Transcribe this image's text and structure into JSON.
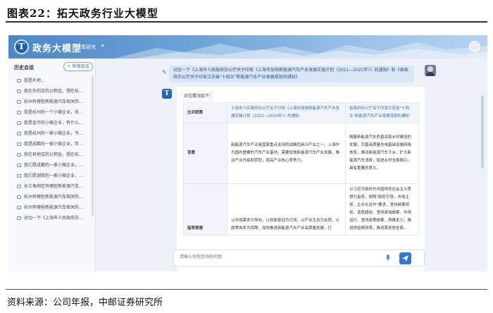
{
  "figure": {
    "title": "图表22：拓天政务行业大模型",
    "source": "资料来源：公司年报，中邮证券研究所"
  },
  "app": {
    "logo_glyph": "T",
    "brand": "政务大模型",
    "mode_selector": "政策研究",
    "colors": {
      "header": "#4d87c9",
      "accent": "#2e7ad3",
      "bubble": "#d9e6f5"
    }
  },
  "sidebar": {
    "heading": "历史会话",
    "new_chat_label": "+ 新增会话",
    "items": [
      "我是外地...",
      "我在外的交的公积金，想在杭州买...",
      "杭州有哪些新能源汽车相关的政策?",
      "我是杭州的一个小微企业，去年营...",
      "我是金华的小微企业，有什么扶持...",
      "我是杭州的一家小微企业，今年有...",
      "我是成都的一家小微企业，年收20...",
      "我在异地交的公积金，想在杭州买...",
      "我们是成都的一家小微企业，去年...",
      "我们是湖南的一家小微企业，营收...",
      "长三角地区有哪些新能源汽车的政策?",
      "杭州有哪些新能源汽车相关的政策?",
      "杭州有哪些新能源汽车相关的政策?",
      "对比一下《上海市人民政府办公厅..."
    ]
  },
  "chat": {
    "user_message": "对比一下《上海市人民政府办公厅关于印发《上海市加快新能源汽车产业发展实施计划（2021—2025年）》的通知》和《省政府办公厅关于印发江苏省\"十四五\"新能源汽车产业发展规划的通知》",
    "answer_intro": "对比情况如下：",
    "table": {
      "headers": [
        "比对政策",
        "上海市人民政府办公厅关于印发《上海市加快新能源汽车产业发展实施计划（2021—2025年）》的通知",
        "省政府办公厅关于印发江苏省\"十四五\"新能源汽车产业发展规划的通知"
      ],
      "rows": [
        {
          "label": "背景",
          "a": "新能源汽车产业是国家重点支持的战略性新兴产业之一。上海作为国内重要的汽车产业基地，需要加快新能源汽车产业发展，推动产业升级和转型，提高产业核心竞争力。",
          "b": "随着新能源汽车的普及和乡村建设的发展，完善高质量充电基础设施网络体系，推动新能源汽车下乡，扩大新能源汽车消费，促进乡村全面振兴，具有重要的意义。"
        },
        {
          "label": "指导思想",
          "a": "以市场需求为导向，以创新驱动为引领，以产业生态为支撑，以政策体系为保障，加快推进新能源汽车产业高质量发展，打",
          "b": "以习近平新时代中国特色社会主义思想为指导，按照\"政府引导，市场主导、企业化运作\"要求，坚持统筹规划、适度超前、坚持县域统筹、市场运行、坚持政策统筹，两推发力，推进供给侧改革，推进需求侧全面..."
        }
      ]
    },
    "input_placeholder": "请输入你想咨询的问题"
  }
}
